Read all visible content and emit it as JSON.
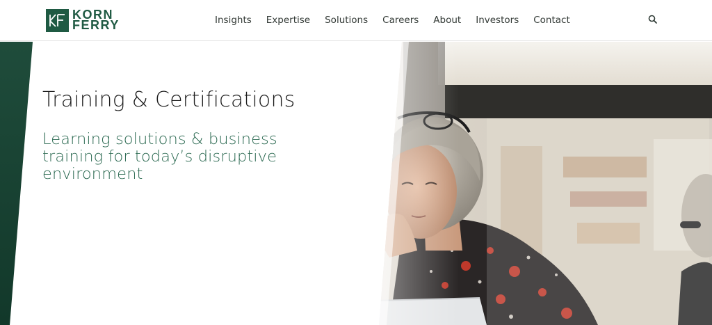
{
  "brand": {
    "logo_line1": "KORN",
    "logo_line2": "FERRY",
    "logo_mark_icon": "kf-monogram-icon",
    "primary_color": "#1f5a43"
  },
  "nav": {
    "items": [
      {
        "label": "Insights"
      },
      {
        "label": "Expertise"
      },
      {
        "label": "Solutions"
      },
      {
        "label": "Careers"
      },
      {
        "label": "About"
      },
      {
        "label": "Investors"
      },
      {
        "label": "Contact"
      }
    ],
    "search_icon": "search-icon"
  },
  "hero": {
    "title": "Training & Certifications",
    "subtitle": "Learning solutions & business training for today’s disruptive environment",
    "accent_color": "#2c6a52"
  }
}
